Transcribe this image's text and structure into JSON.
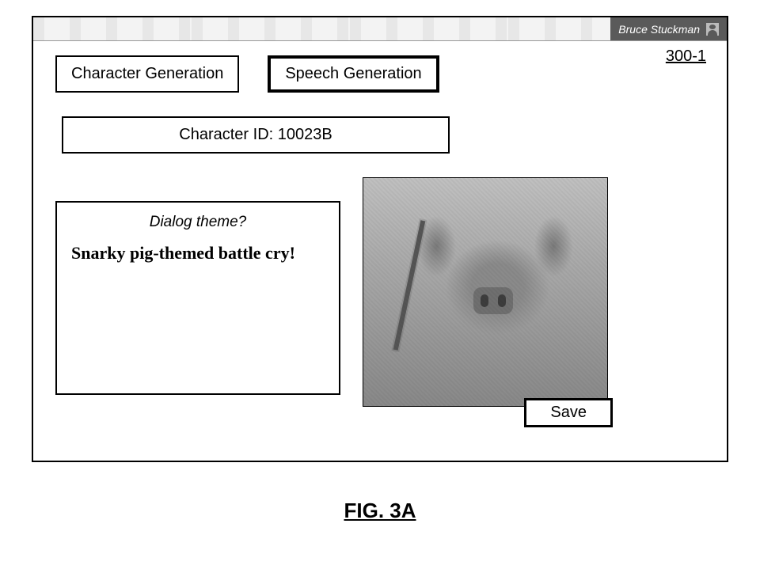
{
  "user": {
    "name": "Bruce Stuckman"
  },
  "figure_ref": "300-1",
  "tabs": {
    "character_gen": "Character Generation",
    "speech_gen": "Speech Generation"
  },
  "character": {
    "id_label": "Character ID: 10023B"
  },
  "dialog": {
    "prompt": "Dialog theme?",
    "text": "Snarky pig-themed battle cry!"
  },
  "buttons": {
    "save": "Save"
  },
  "caption": "FIG. 3A"
}
